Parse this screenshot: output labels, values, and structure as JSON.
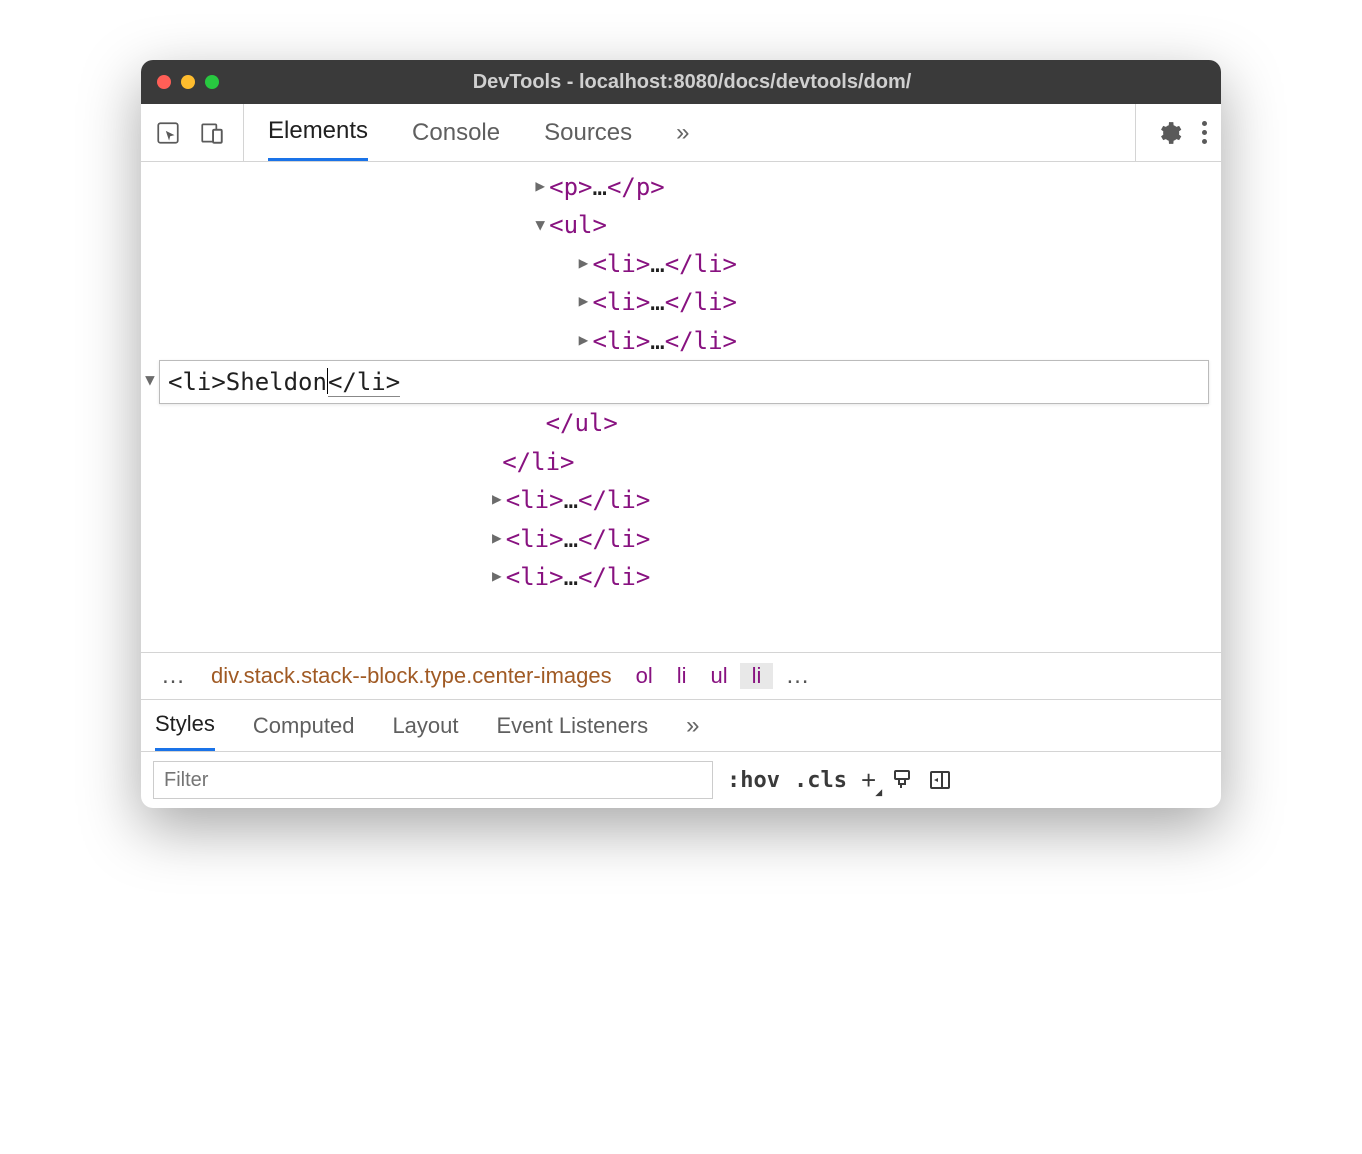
{
  "window": {
    "title": "DevTools - localhost:8080/docs/devtools/dom/"
  },
  "toolbar_tabs": {
    "elements": "Elements",
    "console": "Console",
    "sources": "Sources"
  },
  "dom": {
    "p_open": "<p>",
    "p_ell": "…",
    "p_close": "</p>",
    "ul_open": "<ul>",
    "li_open": "<li>",
    "li_ell": "…",
    "li_close": "</li>",
    "ul_close": "</ul>",
    "edit_content": "<li>Sheldon",
    "edit_closing": "</li>"
  },
  "breadcrumb": {
    "ell_left": "…",
    "div": "div.stack.stack--block.type.center-images",
    "ol": "ol",
    "li1": "li",
    "ul": "ul",
    "li2": "li",
    "ell_right": "…"
  },
  "styles_tabs": {
    "styles": "Styles",
    "computed": "Computed",
    "layout": "Layout",
    "event": "Event Listeners"
  },
  "filter": {
    "placeholder": "Filter",
    "hov": ":hov",
    "cls": ".cls"
  }
}
